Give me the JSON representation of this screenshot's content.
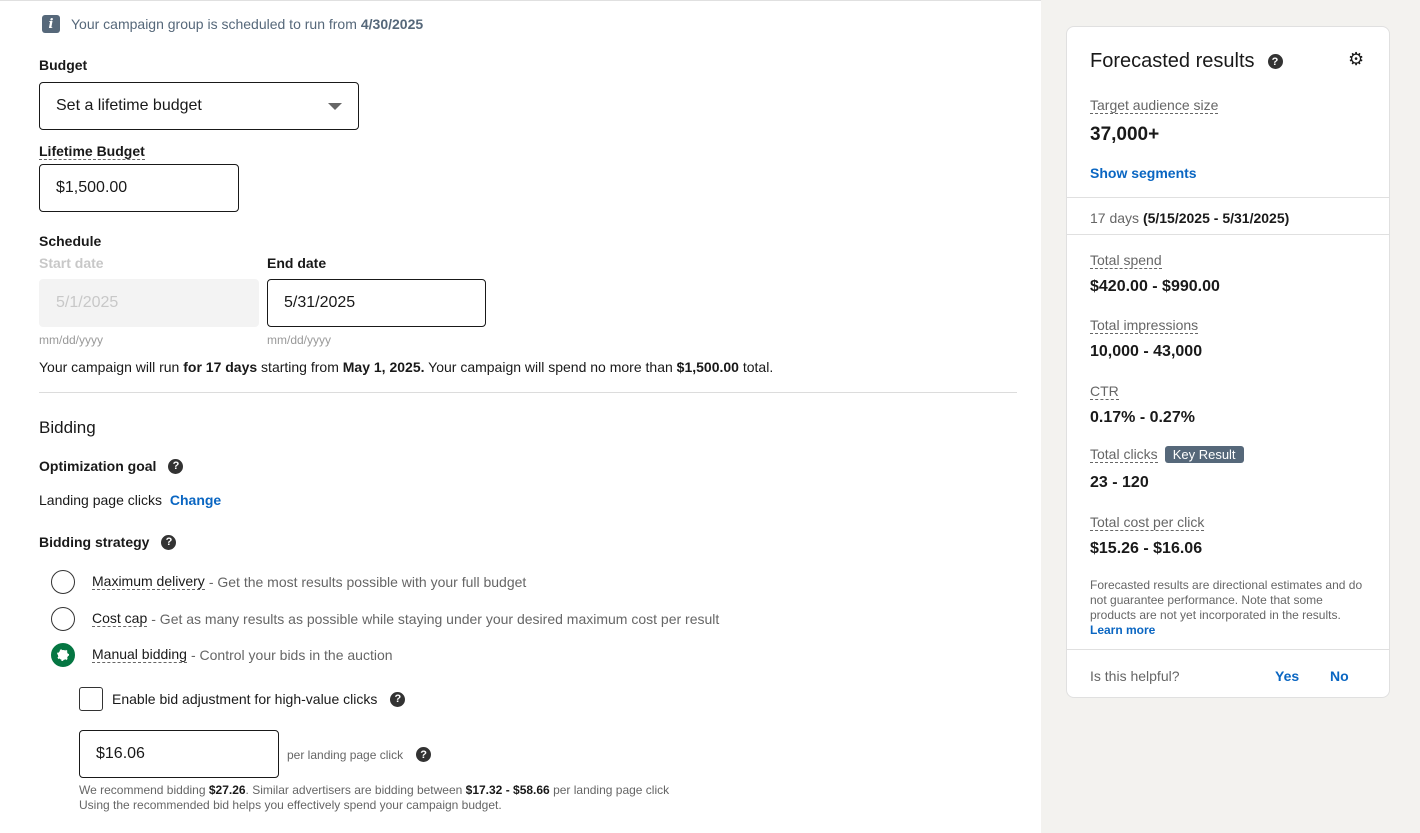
{
  "info": {
    "icon": "info-icon",
    "text": "Your campaign group is scheduled to run from",
    "date": "4/30/2025"
  },
  "budget": {
    "label": "Budget",
    "select_value": "Set a lifetime budget",
    "lifetime_label": "Lifetime Budget",
    "lifetime_value": "$1,500.00"
  },
  "schedule": {
    "label": "Schedule",
    "start_label": "Start date",
    "start_value": "5/1/2025",
    "start_hint": "mm/dd/yyyy",
    "end_label": "End date",
    "end_value": "5/31/2025",
    "end_hint": "mm/dd/yyyy",
    "summary": {
      "p1": "Your campaign will run ",
      "days": "for 17 days",
      "p2": " starting from ",
      "start": "May 1, 2025.",
      "p3": " Your campaign will spend no more than ",
      "amount": "$1,500.00",
      "p4": " total."
    }
  },
  "bidding": {
    "heading": "Bidding",
    "goal_label": "Optimization goal",
    "goal_value": "Landing page clicks",
    "goal_change": "Change",
    "strategy_label": "Bidding strategy",
    "options": [
      {
        "title": "Maximum delivery",
        "desc": "- Get the most results possible with your full budget",
        "selected": false
      },
      {
        "title": "Cost cap",
        "desc": "- Get as many results as possible while staying under your desired maximum cost per result",
        "selected": false
      },
      {
        "title": "Manual bidding",
        "desc": "- Control your bids in the auction",
        "selected": true
      }
    ],
    "adjust_label": "Enable bid adjustment for high-value clicks",
    "bid_value": "$16.06",
    "bid_unit": "per landing page click",
    "rec": {
      "p1": "We recommend bidding ",
      "rec_bid": "$27.26",
      "p2": ". Similar advertisers are bidding between ",
      "range": "$17.32 - $58.66",
      "p3": " per landing page click",
      "line2": "Using the recommended bid helps you effectively spend your campaign budget."
    }
  },
  "forecast": {
    "title": "Forecasted results",
    "audience_label": "Target audience size",
    "audience_value": "37,000+",
    "show_segments": "Show segments",
    "days_prefix": "17 days",
    "days_range": "(5/15/2025 - 5/31/2025)",
    "spend_label": "Total spend",
    "spend_value": "$420.00 - $990.00",
    "impr_label": "Total impressions",
    "impr_value": "10,000 - 43,000",
    "ctr_label": "CTR",
    "ctr_value": "0.17% - 0.27%",
    "clicks_label": "Total clicks",
    "clicks_badge": "Key Result",
    "clicks_value": "23 - 120",
    "cpc_label": "Total cost per click",
    "cpc_value": "$15.26 - $16.06",
    "disclaimer": "Forecasted results are directional estimates and do not guarantee performance. Note that some products are not yet incorporated in the results.",
    "learn_more": "Learn more",
    "helpful": "Is this helpful?",
    "yes": "Yes",
    "no": "No"
  }
}
